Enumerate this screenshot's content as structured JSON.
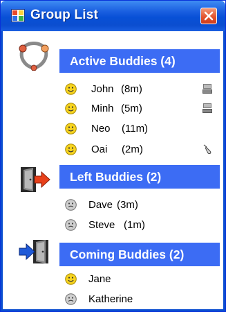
{
  "window": {
    "title": "Group List"
  },
  "icons": {
    "app": "grid-window-icon",
    "close": "close-icon",
    "active_group": "network-links-icon",
    "left_group": "exit-door-icon",
    "coming_group": "enter-door-icon",
    "online_face": "smiley-online-icon",
    "offline_face": "smiley-offline-icon",
    "keyboard_status": "keyboard-status-icon",
    "mouse_status": "mouse-status-icon"
  },
  "colors": {
    "titlebar": "#0b4ed0",
    "header": "#3c6cf4",
    "online": "#f6d31f",
    "offline": "#c9c9c9",
    "close": "#e2502b"
  },
  "groups": [
    {
      "label": "Active Buddies (4)",
      "buddies": [
        {
          "name": "John",
          "time": "(8m)",
          "status": "keyboard"
        },
        {
          "name": "Minh",
          "time": "(5m)",
          "status": "keyboard"
        },
        {
          "name": "Neo",
          "time": "(11m)",
          "status": ""
        },
        {
          "name": "Oai",
          "time": "(2m)",
          "status": "mouse"
        }
      ]
    },
    {
      "label": "Left Buddies (2)",
      "buddies": [
        {
          "name": "Dave",
          "time": "(3m)"
        },
        {
          "name": "Steve",
          "time": "(1m)"
        }
      ]
    },
    {
      "label": "Coming Buddies (2)",
      "buddies": [
        {
          "name": "Jane"
        },
        {
          "name": "Katherine"
        }
      ]
    }
  ]
}
